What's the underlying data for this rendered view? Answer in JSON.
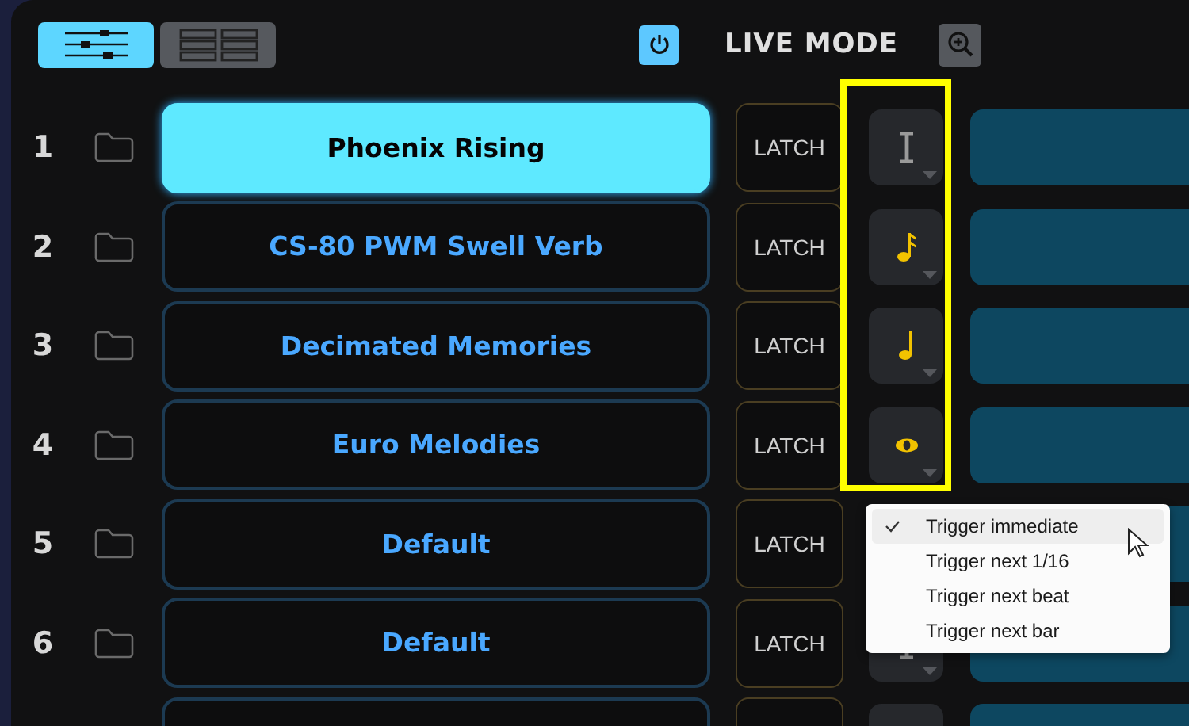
{
  "toolbar": {
    "view_buttons": [
      {
        "kind": "mixer",
        "selected": true
      },
      {
        "kind": "grid",
        "selected": false
      }
    ],
    "power": {
      "on": true
    },
    "title": "LIVE MODE"
  },
  "rows": [
    {
      "number": "1",
      "name": "Phoenix Rising",
      "selected": true,
      "latch": "LATCH",
      "kind": "immediate"
    },
    {
      "number": "2",
      "name": "CS-80 PWM Swell Verb",
      "selected": false,
      "latch": "LATCH",
      "kind": "sixteenth"
    },
    {
      "number": "3",
      "name": "Decimated Memories",
      "selected": false,
      "latch": "LATCH",
      "kind": "quarter"
    },
    {
      "number": "4",
      "name": "Euro Melodies",
      "selected": false,
      "latch": "LATCH",
      "kind": "whole"
    },
    {
      "number": "5",
      "name": "Default",
      "selected": false,
      "latch": "LATCH"
    },
    {
      "number": "6",
      "name": "Default",
      "selected": false,
      "latch": "LATCH",
      "kind": "immediate"
    },
    {
      "selected": false,
      "kind": "blank"
    }
  ],
  "trigger_menu": {
    "items": [
      {
        "label": "Trigger immediate",
        "selected": true,
        "hovered": true
      },
      {
        "label": "Trigger next 1/16",
        "selected": false,
        "hovered": false
      },
      {
        "label": "Trigger next beat",
        "selected": false,
        "hovered": false
      },
      {
        "label": "Trigger next bar",
        "selected": false,
        "hovered": false
      }
    ]
  }
}
